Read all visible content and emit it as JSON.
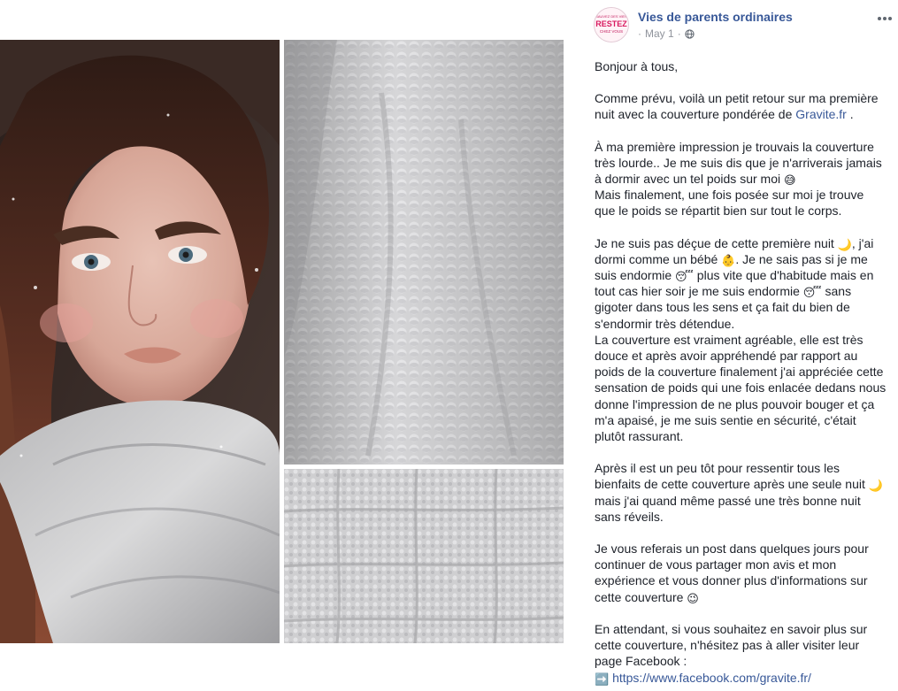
{
  "page": {
    "name": "Vies de parents ordinaires",
    "avatar_logo_lines": [
      "SAUVEZ DES VIES",
      "RESTEZ",
      "CHEZ VOUS"
    ],
    "date": "May 1",
    "audience_icon": "globe-icon",
    "more_icon": "more-options-icon"
  },
  "photos": {
    "selfie_icon": "photo-selfie",
    "blanket_top_icon": "photo-blanket-top",
    "blanket_bottom_icon": "photo-blanket-bottom"
  },
  "post": {
    "p1": "Bonjour à tous,",
    "p2_a": "Comme prévu, voilà un petit retour sur ma première nuit avec la couverture pondérée de ",
    "p2_link": "Gravite.fr",
    "p2_b": " .",
    "p3_a": "À ma première impression je trouvais la couverture très lourde.. Je me suis dis que je n'arriverais jamais à dormir avec un tel poids sur moi ",
    "p3_emoji": "😅",
    "p3_b": "Mais finalement, une fois posée sur moi je trouve que le poids se répartit bien sur tout le corps.",
    "p4_a": "Je ne suis pas déçue de cette première nuit ",
    "p4_moon": "🌙",
    "p4_b": ", j'ai dormi comme un bébé ",
    "p4_baby": "👶",
    "p4_c": ". Je ne sais pas si je me suis endormie ",
    "p4_sleep1": "😴",
    "p4_d": " plus vite que d'habitude mais en tout cas hier soir je me suis endormie ",
    "p4_sleep2": "😴",
    "p4_e": " sans gigoter dans tous les sens et ça fait du bien de s'endormir très détendue.",
    "p4_f": "La couverture est vraiment agréable, elle est très douce et après avoir appréhendé par rapport au poids de la couverture finalement j'ai appréciée cette sensation de poids qui une fois enlacée dedans nous donne l'impression de ne plus pouvoir bouger et ça m'a apaisé, je me suis sentie en sécurité, c'était plutôt rassurant.",
    "p5_a": "Après il est un peu tôt pour ressentir tous les bienfaits de cette couverture après une seule nuit ",
    "p5_moon": "🌙",
    "p5_b": " mais j'ai quand même passé une très bonne nuit sans réveils.",
    "p6_a": "Je vous referais un post dans quelques jours pour continuer de vous partager mon avis et mon expérience et vous donner plus d'informations sur cette couverture ",
    "p6_emoji": "😉",
    "p7_a": "En attendant, si vous souhaitez en savoir plus sur cette couverture, n'hésitez pas à aller visiter leur page Facebook :",
    "p7_arrow": "➡️",
    "p7_link": "https://www.facebook.com/gravite.fr/"
  }
}
